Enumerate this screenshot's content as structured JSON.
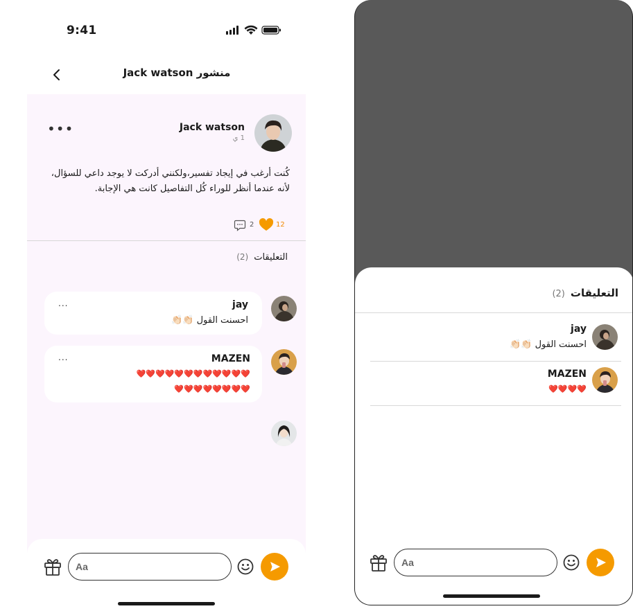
{
  "status_bar": {
    "time": "9:41"
  },
  "header": {
    "title": "منشور Jack watson"
  },
  "post": {
    "author": "Jack watson",
    "time": "1 ي",
    "body_line1": "كُنت أرغب في إيجاد تفسير،ولكنني أدركت لا يوجد داعي للسؤال،",
    "body_line2": "لأنه عندما أنظر للوراء كُل التفاصيل كانت هي الإجابة.",
    "comment_count": "2",
    "like_count": "12",
    "more_label": "•••"
  },
  "comments": {
    "title": "التعليقات",
    "count": "(2)",
    "items": [
      {
        "name": "jay",
        "text": "احسنت القول 👏🏻👏🏻",
        "more": "..."
      },
      {
        "name": "MAZEN",
        "text_line1": "❤️❤️❤️❤️❤️❤️❤️❤️❤️❤️❤️❤️",
        "text_line2": "❤️❤️❤️❤️❤️❤️❤️❤️",
        "more": "..."
      }
    ]
  },
  "composer": {
    "placeholder": "Aa"
  },
  "sheet": {
    "title": "التعليقات",
    "count": "(2)",
    "items": [
      {
        "name": "jay",
        "text": "احسنت القول 👏🏻👏🏻"
      },
      {
        "name": "MAZEN",
        "text": "❤️❤️❤️❤️"
      }
    ],
    "placeholder": "Aa"
  },
  "colors": {
    "accent": "#f59a00",
    "pink_bg": "#fcf5fd",
    "overlay": "#595959"
  }
}
